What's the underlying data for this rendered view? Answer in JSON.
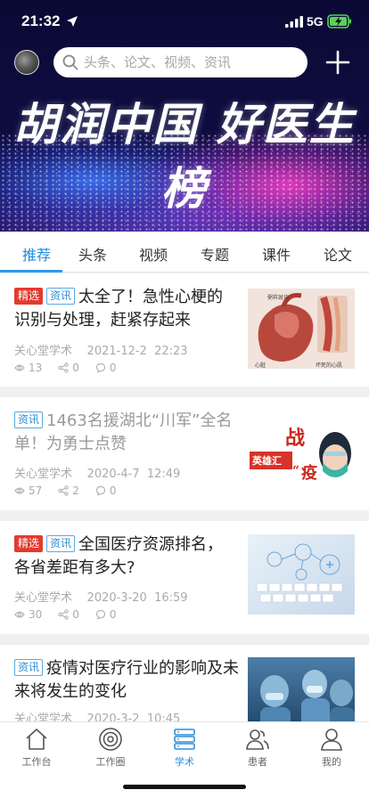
{
  "status": {
    "time": "21:32",
    "network": "5G"
  },
  "hero": {
    "title": "胡润中国 好医生榜"
  },
  "search": {
    "placeholder": "头条、论文、视频、资讯"
  },
  "tabs": [
    {
      "label": "推荐",
      "active": true
    },
    {
      "label": "头条"
    },
    {
      "label": "视频"
    },
    {
      "label": "专题"
    },
    {
      "label": "课件"
    },
    {
      "label": "论文"
    }
  ],
  "articles": [
    {
      "tags": [
        "精选",
        "资讯"
      ],
      "title": "太全了！急性心梗的识别与处理，赶紧存起来",
      "source": "关心堂学术",
      "date": "2021-12-2",
      "time": "22:23",
      "views": "13",
      "shares": "0",
      "comments": "0",
      "read": false,
      "thumb_labels": [
        "粥样斑块",
        "心脏",
        "坏死的心肌"
      ]
    },
    {
      "tags": [
        "资讯"
      ],
      "title": "1463名援湖北“川军”全名单！为勇士点赞",
      "source": "关心堂学术",
      "date": "2020-4-7",
      "time": "12:49",
      "views": "57",
      "shares": "2",
      "comments": "0",
      "read": true,
      "thumb_labels": [
        "战",
        "英雄汇",
        "“",
        "疫"
      ]
    },
    {
      "tags": [
        "精选",
        "资讯"
      ],
      "title": "全国医疗资源排名，各省差距有多大?",
      "source": "关心堂学术",
      "date": "2020-3-20",
      "time": "16:59",
      "views": "30",
      "shares": "0",
      "comments": "0",
      "read": false
    },
    {
      "tags": [
        "资讯"
      ],
      "title": "疫情对医疗行业的影响及未来将发生的变化",
      "source": "关心堂学术",
      "date": "2020-3-2",
      "time": "10:45",
      "read": false
    }
  ],
  "bottom_nav": [
    {
      "label": "工作台",
      "icon": "home-icon"
    },
    {
      "label": "工作圈",
      "icon": "circle-icon"
    },
    {
      "label": "学术",
      "icon": "server-icon",
      "active": true
    },
    {
      "label": "患者",
      "icon": "patients-icon"
    },
    {
      "label": "我的",
      "icon": "profile-icon"
    }
  ],
  "colors": {
    "accent": "#1e8fdb",
    "tag_red": "#e33a2e",
    "hero_bg": "#0d0c3f"
  }
}
